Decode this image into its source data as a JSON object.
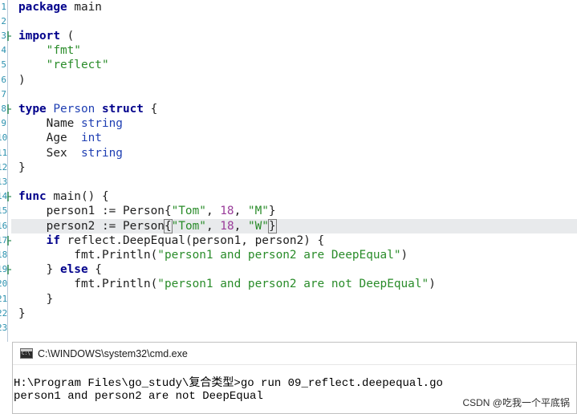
{
  "editor": {
    "line_numbers": [
      "1",
      "2",
      "3",
      "4",
      "5",
      "6",
      "7",
      "8",
      "9",
      "10",
      "11",
      "12",
      "13",
      "14",
      "15",
      "16",
      "17",
      "18",
      "19",
      "20",
      "21",
      "22",
      "23"
    ],
    "lines": [
      [
        {
          "t": "package",
          "c": "kw"
        },
        {
          "t": " main",
          "c": ""
        }
      ],
      [],
      [
        {
          "t": "import",
          "c": "kw"
        },
        {
          "t": " (",
          "c": ""
        }
      ],
      [
        {
          "t": "    ",
          "c": ""
        },
        {
          "t": "\"fmt\"",
          "c": "str"
        }
      ],
      [
        {
          "t": "    ",
          "c": ""
        },
        {
          "t": "\"reflect\"",
          "c": "str"
        }
      ],
      [
        {
          "t": ")",
          "c": ""
        }
      ],
      [],
      [
        {
          "t": "type",
          "c": "kw"
        },
        {
          "t": " ",
          "c": ""
        },
        {
          "t": "Person",
          "c": "ty"
        },
        {
          "t": " ",
          "c": ""
        },
        {
          "t": "struct",
          "c": "kw"
        },
        {
          "t": " {",
          "c": ""
        }
      ],
      [
        {
          "t": "    Name ",
          "c": ""
        },
        {
          "t": "string",
          "c": "ty"
        }
      ],
      [
        {
          "t": "    Age  ",
          "c": ""
        },
        {
          "t": "int",
          "c": "ty"
        }
      ],
      [
        {
          "t": "    Sex  ",
          "c": ""
        },
        {
          "t": "string",
          "c": "ty"
        }
      ],
      [
        {
          "t": "}",
          "c": ""
        }
      ],
      [],
      [
        {
          "t": "func",
          "c": "kw"
        },
        {
          "t": " main() {",
          "c": ""
        }
      ],
      [
        {
          "t": "    person1 := Person{",
          "c": ""
        },
        {
          "t": "\"Tom\"",
          "c": "str"
        },
        {
          "t": ", ",
          "c": ""
        },
        {
          "t": "18",
          "c": "num"
        },
        {
          "t": ", ",
          "c": ""
        },
        {
          "t": "\"M\"",
          "c": "str"
        },
        {
          "t": "}",
          "c": ""
        }
      ],
      [
        {
          "t": "    person2 := Person",
          "c": ""
        },
        {
          "t": "{",
          "c": "brace-hl"
        },
        {
          "t": "\"Tom\"",
          "c": "str"
        },
        {
          "t": ", ",
          "c": ""
        },
        {
          "t": "18",
          "c": "num"
        },
        {
          "t": ", ",
          "c": ""
        },
        {
          "t": "\"W\"",
          "c": "str"
        },
        {
          "t": "}",
          "c": "brace-hl"
        }
      ],
      [
        {
          "t": "    ",
          "c": ""
        },
        {
          "t": "if",
          "c": "kw"
        },
        {
          "t": " reflect.DeepEqual(person1, person2) {",
          "c": ""
        }
      ],
      [
        {
          "t": "        fmt.Println(",
          "c": ""
        },
        {
          "t": "\"person1 and person2 are DeepEqual\"",
          "c": "str"
        },
        {
          "t": ")",
          "c": ""
        }
      ],
      [
        {
          "t": "    } ",
          "c": ""
        },
        {
          "t": "else",
          "c": "kw"
        },
        {
          "t": " {",
          "c": ""
        }
      ],
      [
        {
          "t": "        fmt.Println(",
          "c": ""
        },
        {
          "t": "\"person1 and person2 are not DeepEqual\"",
          "c": "str"
        },
        {
          "t": ")",
          "c": ""
        }
      ],
      [
        {
          "t": "    }",
          "c": ""
        }
      ],
      [
        {
          "t": "}",
          "c": ""
        }
      ],
      []
    ],
    "current_line_index": 15,
    "fold_markers": [
      2,
      7,
      13,
      16,
      18
    ]
  },
  "terminal": {
    "title": "C:\\WINDOWS\\system32\\cmd.exe",
    "lines": [
      "H:\\Program Files\\go_study\\复合类型>go run 09_reflect.deepequal.go",
      "person1 and person2 are not DeepEqual"
    ]
  },
  "watermark": "CSDN @吃我一个平底锅",
  "colors": {
    "keyword": "#00008b",
    "type": "#1f3fb3",
    "string": "#2a8c2a",
    "number": "#9a3c9a",
    "line_number": "#2b91af",
    "current_line": "#e8eaec"
  }
}
